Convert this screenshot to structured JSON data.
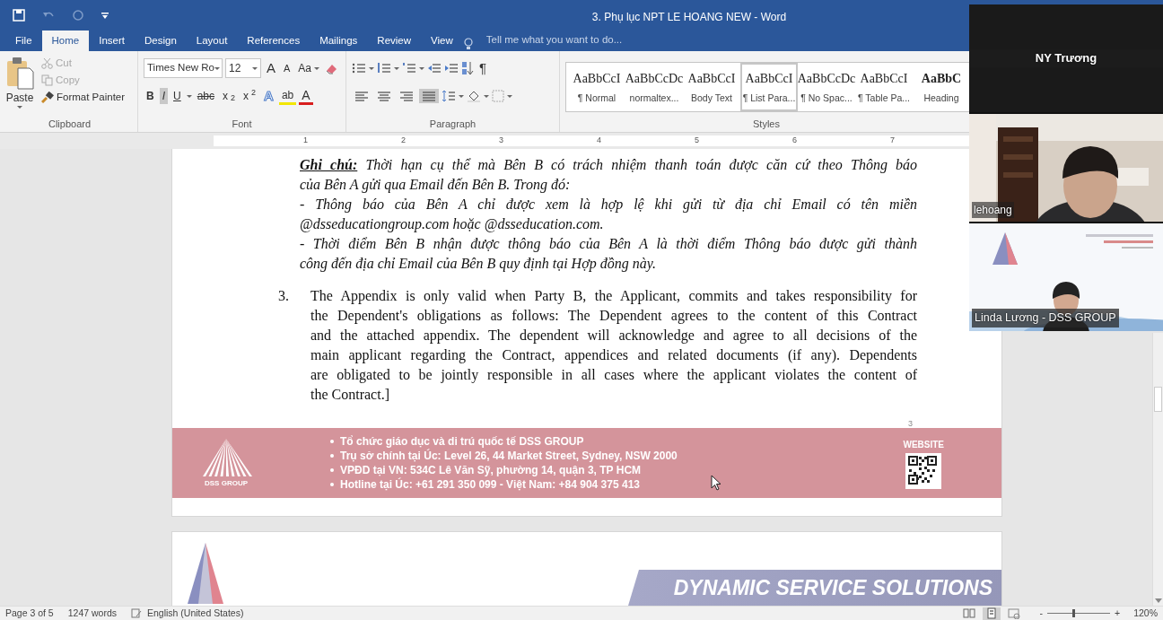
{
  "window": {
    "title": "3. Phụ lục NPT LE HOANG NEW - Word"
  },
  "tabs": [
    {
      "label": "File",
      "selected": false
    },
    {
      "label": "Home",
      "selected": true
    },
    {
      "label": "Insert",
      "selected": false
    },
    {
      "label": "Design",
      "selected": false
    },
    {
      "label": "Layout",
      "selected": false
    },
    {
      "label": "References",
      "selected": false
    },
    {
      "label": "Mailings",
      "selected": false
    },
    {
      "label": "Review",
      "selected": false
    },
    {
      "label": "View",
      "selected": false
    }
  ],
  "tell_me": {
    "placeholder": "Tell me what you want to do..."
  },
  "clipboard": {
    "paste": "Paste",
    "cut": {
      "label": "Cut",
      "disabled": true
    },
    "copy": {
      "label": "Copy",
      "disabled": true
    },
    "format_painter": {
      "label": "Format Painter",
      "disabled": false
    },
    "group_label": "Clipboard"
  },
  "font": {
    "family": "Times New Ro",
    "size": "12",
    "grow": "A",
    "shrink": "A",
    "change_case": "Aa",
    "format_buttons": [
      {
        "label": "B",
        "selected": false
      },
      {
        "label": "I",
        "selected": true
      },
      {
        "label": "U",
        "selected": false
      },
      {
        "label": "abc",
        "selected": false
      },
      {
        "label": "x$_{2}$",
        "selected": false
      },
      {
        "label": "x$^{2}$",
        "selected": false
      }
    ],
    "effects": "A",
    "highlight": "ab",
    "font_color": "A",
    "group_label": "Font"
  },
  "paragraph": {
    "show_marks": "¶",
    "alignment": [
      {
        "selected": false
      },
      {
        "selected": false
      },
      {
        "selected": false
      },
      {
        "selected": true
      }
    ],
    "group_label": "Paragraph"
  },
  "styles": {
    "items": [
      {
        "preview": "AaBbCcI",
        "name": "¶ Normal",
        "selected": false
      },
      {
        "preview": "AaBbCcDc",
        "name": "normaltex...",
        "selected": false
      },
      {
        "preview": "AaBbCcI",
        "name": "Body Text",
        "selected": false
      },
      {
        "preview": "AaBbCcI",
        "name": "¶ List Para...",
        "selected": true
      },
      {
        "preview": "AaBbCcDc",
        "name": "¶ No Spac...",
        "selected": false
      },
      {
        "preview": "AaBbCcI",
        "name": "¶ Table Pa...",
        "selected": false
      },
      {
        "preview": "AaBbC",
        "name": "Heading",
        "selected": false
      }
    ],
    "group_label": "Styles"
  },
  "ruler": {
    "numbers": [
      "1",
      "2",
      "3",
      "4",
      "5",
      "6",
      "7"
    ]
  },
  "document": {
    "note": {
      "label": "Ghi chú:",
      "paragraphs": [
        [
          "Thời hạn cụ thể mà Bên B có trách nhiệm thanh toán được căn cứ theo Thông báo",
          "của Bên A gửi qua Email đến Bên B. Trong đó:"
        ],
        [
          "- Thông báo của Bên A chỉ được xem là hợp lệ khi gửi từ địa chỉ Email có tên miền",
          "@dsseducationgroup.com hoặc @dsseducation.com."
        ],
        [
          "- Thời điểm Bên B nhận được thông báo của Bên A là thời điểm Thông báo được gửi thành",
          "công đến địa chỉ Email của Bên B quy định tại Hợp đồng này."
        ]
      ]
    },
    "item": {
      "number": "3.",
      "lines": [
        "The Appendix is only valid when Party B, the Applicant, commits and takes responsibility for",
        "the Dependent's obligations as follows: The Dependent agrees to the content of this Contract",
        "and the attached appendix. The dependent will acknowledge and agree to all decisions of the",
        "main applicant regarding the Contract, appendices and related documents (if any). Dependents",
        "are obligated to be jointly responsible in all cases where the applicant violates the content of",
        "the Contract.]"
      ]
    },
    "page_number": "3",
    "footer": {
      "logo_text": "DSS GROUP",
      "lines": [
        "Tổ chức giáo dục và di trú quốc tế DSS GROUP",
        "Trụ sở chính tại Úc: Level 26, 44 Market Street, Sydney, NSW 2000",
        "VPĐD tại VN:  534C Lê Văn Sỹ, phường 14, quận 3, TP HCM",
        "Hotline tại Úc: +61 291 350 099 - Việt Nam: +84 904 375 413"
      ],
      "website_label": "WEBSITE"
    },
    "next_page": {
      "banner": "DYNAMIC SERVICE SOLUTIONS"
    }
  },
  "status_bar": {
    "page": "Page 3 of 5",
    "words": "1247 words",
    "language": "English (United States)",
    "views": [
      {
        "selected": false
      },
      {
        "selected": true
      },
      {
        "selected": false
      }
    ],
    "zoom_out": "-",
    "zoom_in": "+",
    "zoom": {
      "level": 0.4
    },
    "zoom_reading": "120%"
  },
  "participants": [
    {
      "name": "NY Trương",
      "kind": "name_only"
    },
    {
      "name": "lehoang",
      "kind": "video"
    },
    {
      "name": "Linda Lương - DSS GROUP",
      "kind": "slide"
    }
  ]
}
